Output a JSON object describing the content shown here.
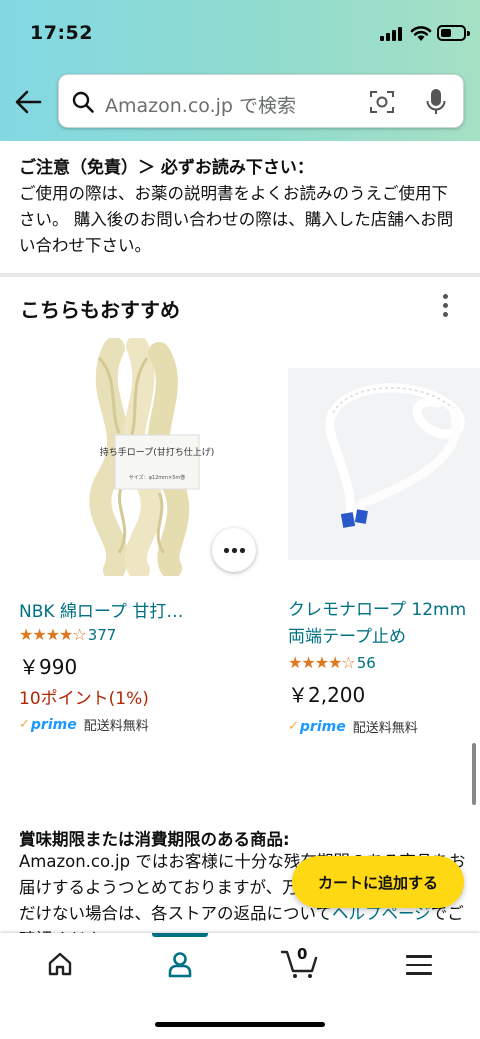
{
  "status_bar": {
    "time": "17:52"
  },
  "search": {
    "placeholder": "Amazon.co.jp で検索"
  },
  "notice": {
    "title": "ご注意（免責）＞ 必ずお読み下さい：",
    "body": "ご使用の際は、お薬の説明書をよくお読みのうえご使用下さい。 購入後のお問い合わせの際は、購入した店舗へお問い合わせ下さい。"
  },
  "recommend": {
    "title": "こちらもおすすめ",
    "products": [
      {
        "name": "NBK 綿ロープ 甘打…",
        "rating_stars": "★★★★☆",
        "rating_value": 4.0,
        "rating_count": "377",
        "price": "￥990",
        "points": "10ポイント(1%)",
        "prime": "prime",
        "shipping": "配送料無料",
        "image_label": "持ち手ロープ(甘打ち仕上げ)",
        "image_sublabel": "サイズ：φ12mm×5m巻"
      },
      {
        "name_line1": "クレモナロープ 12mm",
        "name_line2": "両端テープ止め",
        "rating_stars": "★★★★☆",
        "rating_value": 4.0,
        "rating_count": "56",
        "price": "￥2,200",
        "prime": "prime",
        "shipping": "配送料無料"
      }
    ]
  },
  "expiry": {
    "title": "賞味期限または消費期限のある商品:",
    "body_prefix": "Amazon.co.jp ではお客様に十分な残存期間のある商品をお届けするようつとめておりますが、万が一商品にご満足いただけない場合は、各ストアの返品について",
    "help_link": "ヘルプページ",
    "body_suffix": "でご確認ください。"
  },
  "cart_button": {
    "label": "カートに追加する"
  },
  "bottom_nav": {
    "cart_count": "0"
  },
  "colors": {
    "accent_link": "#007185",
    "star": "#de7921",
    "cart_button": "#ffd814",
    "points": "#b12704",
    "prime": "#1a98ff"
  }
}
